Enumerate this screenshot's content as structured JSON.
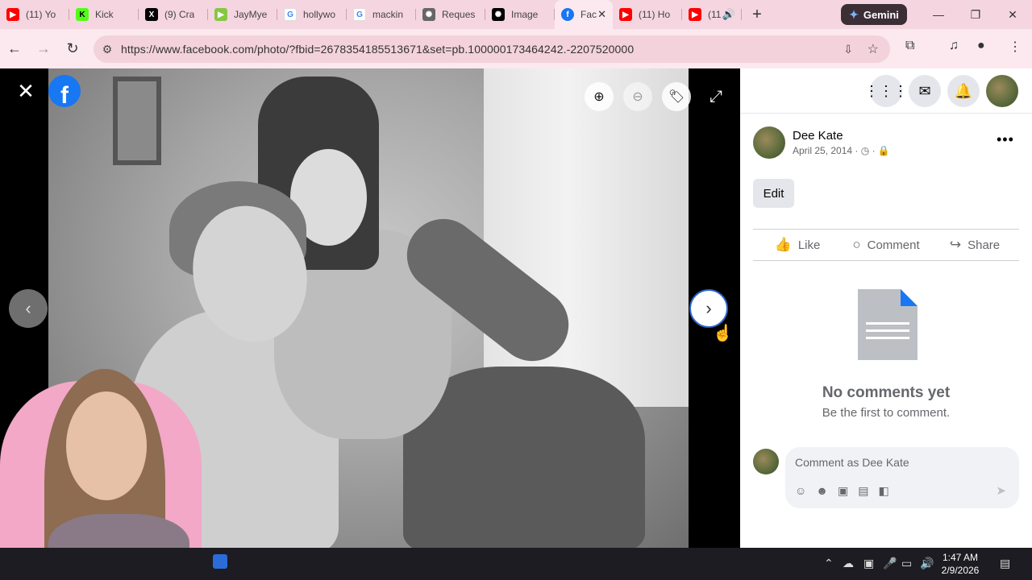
{
  "browser": {
    "tabs": [
      {
        "title": "(11) Yo",
        "icon": "youtube",
        "color": "#ff0000"
      },
      {
        "title": "Kick",
        "icon": "kick",
        "color": "#53fc18"
      },
      {
        "title": "(9) Cra",
        "icon": "x-logo",
        "color": "#000000"
      },
      {
        "title": "JayMye",
        "icon": "rumble",
        "color": "#85c742"
      },
      {
        "title": "hollywo",
        "icon": "google",
        "color": "#4285f4"
      },
      {
        "title": "mackin",
        "icon": "google",
        "color": "#4285f4"
      },
      {
        "title": "Reques",
        "icon": "openai",
        "color": "#666666"
      },
      {
        "title": "Image",
        "icon": "openai",
        "color": "#000000"
      },
      {
        "title": "Fac",
        "icon": "facebook",
        "color": "#1877f2",
        "active": true
      },
      {
        "title": "(11) Ho",
        "icon": "youtube",
        "color": "#ff0000"
      },
      {
        "title": "(11",
        "icon": "youtube",
        "color": "#ff0000"
      }
    ],
    "gemini_label": "Gemini",
    "url": "https://www.facebook.com/photo/?fbid=2678354185513671&set=pb.100000173464242.-2207520000"
  },
  "post": {
    "author": "Dee Kate",
    "date": "April 25, 2014",
    "edit_label": "Edit",
    "actions": {
      "like": "Like",
      "comment": "Comment",
      "share": "Share"
    },
    "empty_title": "No comments yet",
    "empty_sub": "Be the first to comment.",
    "comment_placeholder": "Comment as Dee Kate"
  },
  "taskbar": {
    "time": "1:47 AM",
    "date": "2/9/2026"
  },
  "colors": {
    "facebook_blue": "#1877f2",
    "tab_bar": "#f5d6e0",
    "toolbar": "#fbe9ef"
  }
}
